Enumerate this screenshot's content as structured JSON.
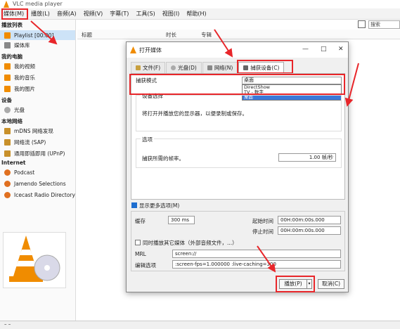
{
  "app": {
    "title": "VLC media player",
    "menu": [
      "媒体(M)",
      "播放(L)",
      "音频(A)",
      "视频(V)",
      "字幕(T)",
      "工具(S)",
      "视图(I)",
      "帮助(H)"
    ],
    "search_placeholder": "搜索"
  },
  "sidebar": {
    "playlist_header": "播放列表",
    "playlist": "Playlist [00:00]",
    "media_library": "媒体库",
    "my_computer": "我的电脑",
    "my_videos": "我的视频",
    "my_music": "我的音乐",
    "my_pictures": "我的图片",
    "devices": "设备",
    "disc": "光盘",
    "local_network": "本地网络",
    "mdns": "mDNS 网络发现",
    "sap": "网络流 (SAP)",
    "upnp": "通用即插即用 (UPnP)",
    "internet": "Internet",
    "podcast": "Podcast",
    "jamendo": "Jamendo Selections",
    "icecast": "Icecast Radio Directory"
  },
  "playlist_columns": [
    "标题",
    "时长",
    "专辑"
  ],
  "dialog": {
    "title": "打开媒体",
    "tabs": [
      "文件(F)",
      "光盘(D)",
      "网络(N)",
      "捕获设备(C)"
    ],
    "capture_mode_label": "捕获模式",
    "capture_mode_value": "桌面",
    "capture_options": [
      "DirectShow",
      "TV - 数字",
      "桌面"
    ],
    "device_selection": "设备选择",
    "device_info": "将打开并播放您的显示器，以便录制或保存。",
    "options_title": "选项",
    "frame_rate_label": "捕获所需的帧率。",
    "frame_rate_value": "1.00 帧/秒",
    "show_more_options": "显示更多选项(M)",
    "cache_label": "缓存",
    "cache_value": "300 ms",
    "start_time_label": "起始时间",
    "start_time_value": "00H:00m:00s.000",
    "stop_time_label": "停止时间",
    "stop_time_value": "00H:00m:00s.000",
    "sync_label": "同时播放其它媒体（外部音频文件，...）",
    "mrl_label": "MRL",
    "mrl_value": "screen://",
    "edit_options_label": "编辑选项",
    "edit_options_value": ":screen-fps=1.000000 :live-caching=300",
    "play_button": "播放(P)",
    "cancel_button": "取消(C)"
  },
  "colors": {
    "accent": "#1f6fd0",
    "highlight": "#e8262a",
    "vlc_orange": "#f08c00"
  }
}
